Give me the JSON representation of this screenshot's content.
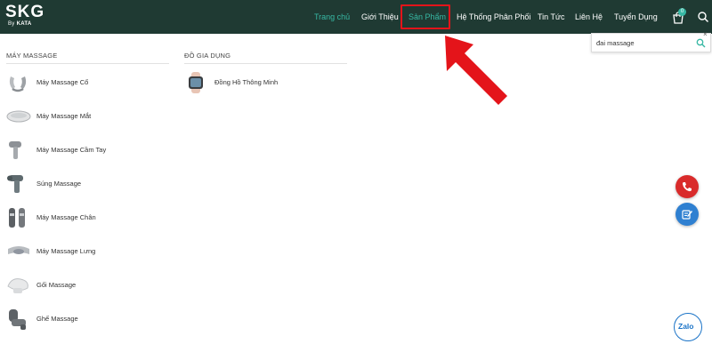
{
  "header": {
    "logo": {
      "main": "SKG",
      "sub_prefix": "By",
      "sub_brand": "KATA"
    },
    "nav": [
      {
        "label": "Trang chủ",
        "active": true
      },
      {
        "label": "Giới Thiệu",
        "active": false
      },
      {
        "label": "Sản Phẩm",
        "active": false,
        "highlighted": true
      },
      {
        "label": "Hệ Thống Phân Phối",
        "active": false
      },
      {
        "label": "Tin Tức",
        "active": false
      },
      {
        "label": "Liên Hệ",
        "active": false
      },
      {
        "label": "Tuyển Dụng",
        "active": false
      }
    ],
    "cart_count": "0",
    "icons": {
      "cart": "cart-icon",
      "search": "search-icon"
    }
  },
  "search": {
    "value": "đai massage",
    "close_label": "×"
  },
  "menu": {
    "massage_machines": {
      "title": "MÁY MASSAGE",
      "items": [
        {
          "label": "Máy Massage Cổ",
          "icon": "neck-massager-icon"
        },
        {
          "label": "Máy Massage Mắt",
          "icon": "eye-massager-icon"
        },
        {
          "label": "Máy Massage Cầm Tay",
          "icon": "handheld-massager-icon"
        },
        {
          "label": "Súng Massage",
          "icon": "massage-gun-icon"
        },
        {
          "label": "Máy Massage Chân",
          "icon": "leg-massager-icon"
        },
        {
          "label": "Máy Massage Lưng",
          "icon": "back-massager-icon"
        },
        {
          "label": "Gối Massage",
          "icon": "massage-pillow-icon"
        },
        {
          "label": "Ghế Massage",
          "icon": "massage-chair-icon"
        }
      ]
    },
    "household": {
      "title": "ĐỒ GIA DỤNG",
      "items": [
        {
          "label": "Đồng Hồ Thông Minh",
          "icon": "smartwatch-icon"
        }
      ]
    }
  },
  "floating": {
    "zalo_label": "Zalo"
  },
  "colors": {
    "header_bg": "#1f3a33",
    "accent": "#37b8a4",
    "highlight": "#e4141a",
    "phone_button": "#d92b2b",
    "note_button": "#2f80d1",
    "zalo": "#1a73c7"
  }
}
